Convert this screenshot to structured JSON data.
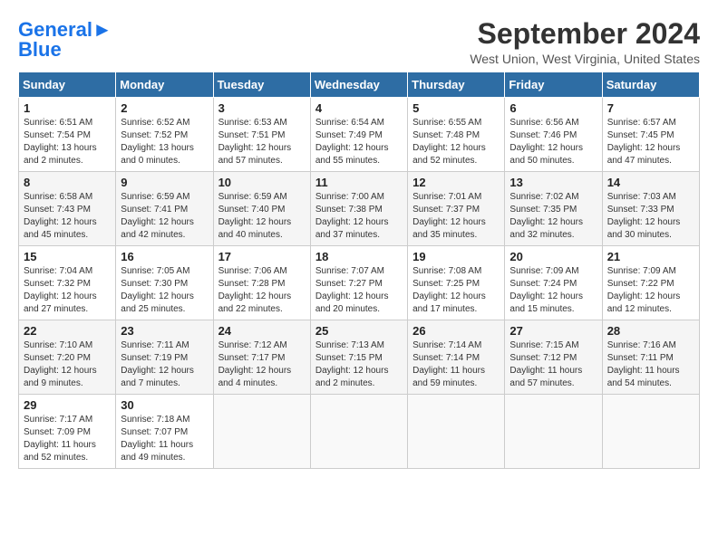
{
  "header": {
    "logo": {
      "part1": "General",
      "part2": "Blue"
    },
    "title": "September 2024",
    "subtitle": "West Union, West Virginia, United States"
  },
  "weekdays": [
    "Sunday",
    "Monday",
    "Tuesday",
    "Wednesday",
    "Thursday",
    "Friday",
    "Saturday"
  ],
  "weeks": [
    [
      {
        "day": "1",
        "text": "Sunrise: 6:51 AM\nSunset: 7:54 PM\nDaylight: 13 hours\nand 2 minutes."
      },
      {
        "day": "2",
        "text": "Sunrise: 6:52 AM\nSunset: 7:52 PM\nDaylight: 13 hours\nand 0 minutes."
      },
      {
        "day": "3",
        "text": "Sunrise: 6:53 AM\nSunset: 7:51 PM\nDaylight: 12 hours\nand 57 minutes."
      },
      {
        "day": "4",
        "text": "Sunrise: 6:54 AM\nSunset: 7:49 PM\nDaylight: 12 hours\nand 55 minutes."
      },
      {
        "day": "5",
        "text": "Sunrise: 6:55 AM\nSunset: 7:48 PM\nDaylight: 12 hours\nand 52 minutes."
      },
      {
        "day": "6",
        "text": "Sunrise: 6:56 AM\nSunset: 7:46 PM\nDaylight: 12 hours\nand 50 minutes."
      },
      {
        "day": "7",
        "text": "Sunrise: 6:57 AM\nSunset: 7:45 PM\nDaylight: 12 hours\nand 47 minutes."
      }
    ],
    [
      {
        "day": "8",
        "text": "Sunrise: 6:58 AM\nSunset: 7:43 PM\nDaylight: 12 hours\nand 45 minutes."
      },
      {
        "day": "9",
        "text": "Sunrise: 6:59 AM\nSunset: 7:41 PM\nDaylight: 12 hours\nand 42 minutes."
      },
      {
        "day": "10",
        "text": "Sunrise: 6:59 AM\nSunset: 7:40 PM\nDaylight: 12 hours\nand 40 minutes."
      },
      {
        "day": "11",
        "text": "Sunrise: 7:00 AM\nSunset: 7:38 PM\nDaylight: 12 hours\nand 37 minutes."
      },
      {
        "day": "12",
        "text": "Sunrise: 7:01 AM\nSunset: 7:37 PM\nDaylight: 12 hours\nand 35 minutes."
      },
      {
        "day": "13",
        "text": "Sunrise: 7:02 AM\nSunset: 7:35 PM\nDaylight: 12 hours\nand 32 minutes."
      },
      {
        "day": "14",
        "text": "Sunrise: 7:03 AM\nSunset: 7:33 PM\nDaylight: 12 hours\nand 30 minutes."
      }
    ],
    [
      {
        "day": "15",
        "text": "Sunrise: 7:04 AM\nSunset: 7:32 PM\nDaylight: 12 hours\nand 27 minutes."
      },
      {
        "day": "16",
        "text": "Sunrise: 7:05 AM\nSunset: 7:30 PM\nDaylight: 12 hours\nand 25 minutes."
      },
      {
        "day": "17",
        "text": "Sunrise: 7:06 AM\nSunset: 7:28 PM\nDaylight: 12 hours\nand 22 minutes."
      },
      {
        "day": "18",
        "text": "Sunrise: 7:07 AM\nSunset: 7:27 PM\nDaylight: 12 hours\nand 20 minutes."
      },
      {
        "day": "19",
        "text": "Sunrise: 7:08 AM\nSunset: 7:25 PM\nDaylight: 12 hours\nand 17 minutes."
      },
      {
        "day": "20",
        "text": "Sunrise: 7:09 AM\nSunset: 7:24 PM\nDaylight: 12 hours\nand 15 minutes."
      },
      {
        "day": "21",
        "text": "Sunrise: 7:09 AM\nSunset: 7:22 PM\nDaylight: 12 hours\nand 12 minutes."
      }
    ],
    [
      {
        "day": "22",
        "text": "Sunrise: 7:10 AM\nSunset: 7:20 PM\nDaylight: 12 hours\nand 9 minutes."
      },
      {
        "day": "23",
        "text": "Sunrise: 7:11 AM\nSunset: 7:19 PM\nDaylight: 12 hours\nand 7 minutes."
      },
      {
        "day": "24",
        "text": "Sunrise: 7:12 AM\nSunset: 7:17 PM\nDaylight: 12 hours\nand 4 minutes."
      },
      {
        "day": "25",
        "text": "Sunrise: 7:13 AM\nSunset: 7:15 PM\nDaylight: 12 hours\nand 2 minutes."
      },
      {
        "day": "26",
        "text": "Sunrise: 7:14 AM\nSunset: 7:14 PM\nDaylight: 11 hours\nand 59 minutes."
      },
      {
        "day": "27",
        "text": "Sunrise: 7:15 AM\nSunset: 7:12 PM\nDaylight: 11 hours\nand 57 minutes."
      },
      {
        "day": "28",
        "text": "Sunrise: 7:16 AM\nSunset: 7:11 PM\nDaylight: 11 hours\nand 54 minutes."
      }
    ],
    [
      {
        "day": "29",
        "text": "Sunrise: 7:17 AM\nSunset: 7:09 PM\nDaylight: 11 hours\nand 52 minutes."
      },
      {
        "day": "30",
        "text": "Sunrise: 7:18 AM\nSunset: 7:07 PM\nDaylight: 11 hours\nand 49 minutes."
      },
      {
        "day": "",
        "text": ""
      },
      {
        "day": "",
        "text": ""
      },
      {
        "day": "",
        "text": ""
      },
      {
        "day": "",
        "text": ""
      },
      {
        "day": "",
        "text": ""
      }
    ]
  ]
}
